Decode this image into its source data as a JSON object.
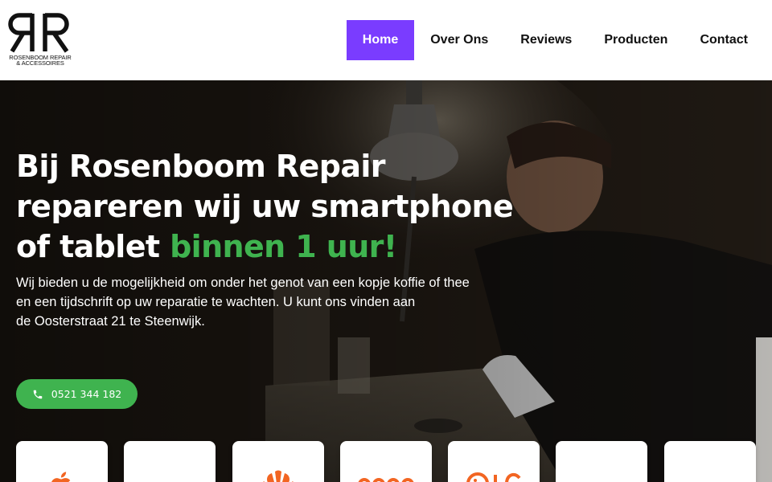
{
  "logo": {
    "monogram": "RR",
    "line1": "ROSENBOOM REPAIR",
    "line2": "& ACCESSOIRES"
  },
  "nav": {
    "items": [
      {
        "label": "Home",
        "active": true
      },
      {
        "label": "Over Ons",
        "active": false
      },
      {
        "label": "Reviews",
        "active": false
      },
      {
        "label": "Producten",
        "active": false
      },
      {
        "label": "Contact",
        "active": false
      }
    ]
  },
  "hero": {
    "headline_line1": "Bij Rosenboom Repair",
    "headline_line2": "repareren wij uw smartphone",
    "headline_line3_plain": "of tablet ",
    "headline_line3_highlight": "binnen 1 uur!",
    "intro_line1": "Wij bieden u de mogelijkheid om onder het genot van een kopje koffie of thee",
    "intro_line2": "en een tijdschrift op uw reparatie te wachten. U kunt ons vinden aan",
    "intro_line3": "de Oosterstraat 21 te Steenwijk.",
    "phone_label": "0521 344 182"
  },
  "brands": {
    "cards": [
      {
        "icon": "apple-logo-icon"
      },
      {
        "icon": "blank-logo"
      },
      {
        "icon": "huawei-logo-icon"
      },
      {
        "icon": "oppo-logo-icon"
      },
      {
        "icon": "lg-logo-icon"
      },
      {
        "icon": "blank-logo"
      },
      {
        "icon": "blank-logo"
      }
    ]
  },
  "colors": {
    "accent_purple": "#7a3cff",
    "accent_green": "#3fb34f",
    "brand_orange": "#f26522"
  }
}
